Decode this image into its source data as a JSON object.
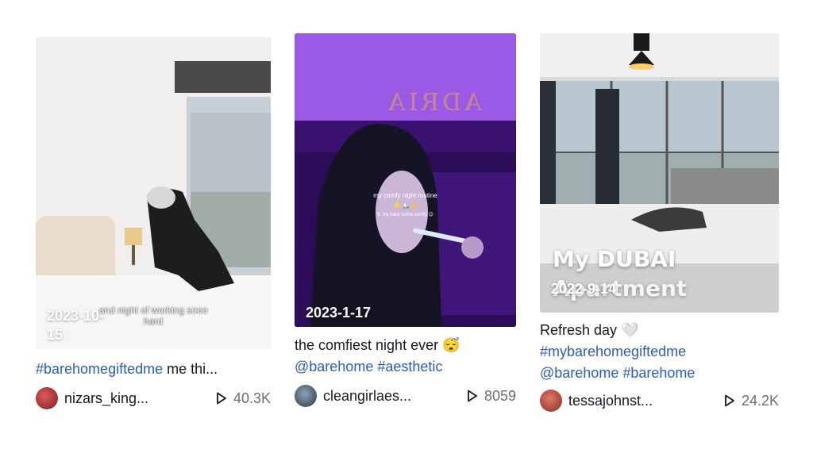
{
  "cards": [
    {
      "date": "2023-10-\n15",
      "overlay_text": "and night of working sooo\nhard",
      "caption_tag": "#barehomegiftedme",
      "caption_rest": " me thi...",
      "username": "nizars_king...",
      "views": "40.3K"
    },
    {
      "date": "2023-1-17",
      "overlay_text": "my comfy night routine",
      "overlay_emoji": "⭐🏔️🌙",
      "overlay_sub": "ft. my bare home comfy 😊",
      "caption_text": "the comfiest night ever 😴",
      "caption_tag1": "@barehome",
      "caption_tag2": "#aesthetic",
      "username": "cleangirlaes...",
      "views": "8059",
      "sign_text": "ADRIA"
    },
    {
      "date": "2022-9-14",
      "overlay_title": "My DUBAI",
      "overlay_title2": "Apartment",
      "caption_text": "Refresh day 🤍",
      "caption_tag1": "#mybarehomegiftedme",
      "caption_tag2": "@barehome",
      "caption_tag3": "#barehome",
      "username": "tessajohnst...",
      "views": "24.2K"
    }
  ],
  "colors": {
    "link": "#2b5db9",
    "text": "#161823",
    "muted": "#6b6d73"
  }
}
